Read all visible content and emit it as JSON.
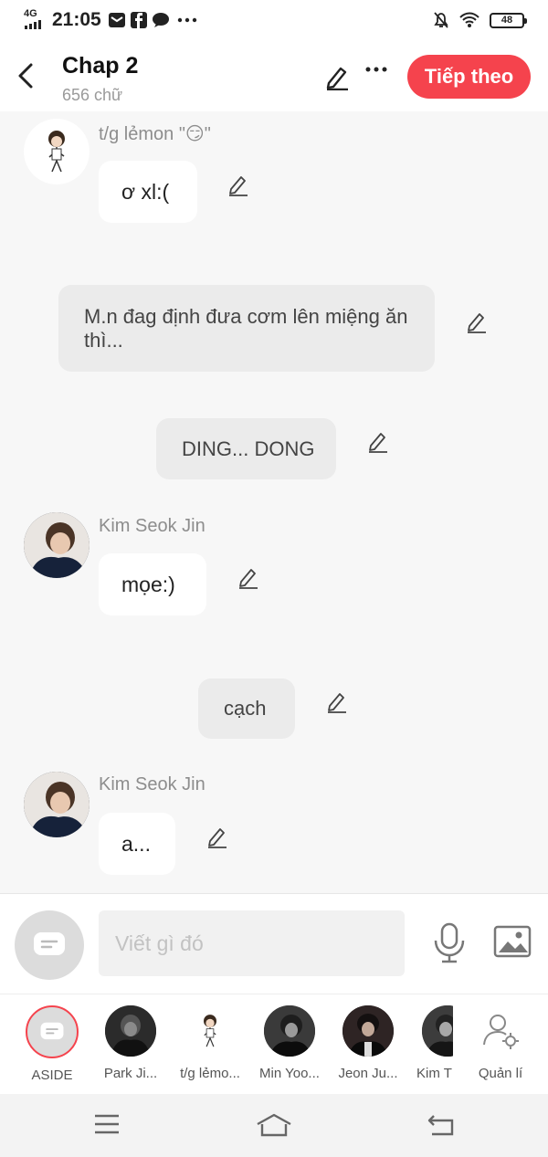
{
  "status_bar": {
    "network": "4G",
    "time": "21:05",
    "battery": "48",
    "icons": [
      "mail-icon",
      "facebook-icon",
      "chat-icon",
      "more-dots-icon",
      "mute-bell-icon",
      "wifi-icon",
      "battery-icon"
    ]
  },
  "header": {
    "title": "Chap 2",
    "subtitle": "656 chữ",
    "next_label": "Tiếp theo"
  },
  "messages": [
    {
      "kind": "character",
      "sender": "t/g lẻmon \"😏\"",
      "text": "ơ xl:(",
      "avatar": "lemon-avatar"
    },
    {
      "kind": "narration",
      "text": "M.n đag định đưa cơm lên miệng ăn thì..."
    },
    {
      "kind": "narration",
      "text": "DING... DONG"
    },
    {
      "kind": "character",
      "sender": "Kim Seok Jin",
      "text": "mọe:)",
      "avatar": "jin-avatar"
    },
    {
      "kind": "narration",
      "text": "cạch"
    },
    {
      "kind": "character",
      "sender": "Kim Seok Jin",
      "text": "a...",
      "avatar": "jin-avatar"
    }
  ],
  "input": {
    "placeholder": "Viết gì đó"
  },
  "characters": [
    {
      "name": "ASIDE"
    },
    {
      "name": "Park Ji..."
    },
    {
      "name": "t/g lẻmo..."
    },
    {
      "name": "Min Yoo..."
    },
    {
      "name": "Jeon Ju..."
    },
    {
      "name": "Kim T"
    },
    {
      "name": "Quản lí"
    }
  ],
  "colors": {
    "accent": "#f5434d",
    "background": "#f7f7f7",
    "bubble": "#ffffff",
    "narration": "#ebebeb"
  }
}
